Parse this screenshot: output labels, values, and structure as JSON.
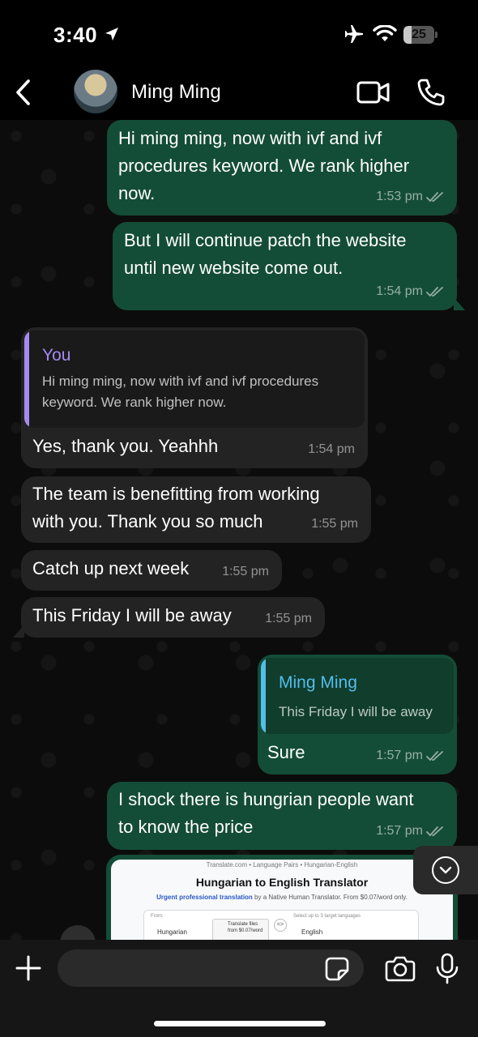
{
  "status_bar": {
    "time": "3:40",
    "battery": "25",
    "battery_level": 0.25
  },
  "header": {
    "contact_name": "Ming Ming"
  },
  "messages": [
    {
      "direction": "out",
      "text": "Hi ming ming, now with ivf and ivf\nprocedures keyword. We rank higher\nnow.",
      "time": "1:53 pm",
      "status": "read"
    },
    {
      "direction": "out",
      "text": "But I will continue patch the website\nuntil new website come out.",
      "time": "1:54 pm",
      "status": "read"
    },
    {
      "direction": "in",
      "quote_author": "You",
      "quote_text": "Hi ming ming, now with ivf and ivf procedures\nkeyword. We rank higher now.",
      "text": "Yes, thank you. Yeahhh",
      "time": "1:54 pm"
    },
    {
      "direction": "in",
      "text": "The team is benefitting from working\nwith you. Thank you so much",
      "time": "1:55 pm"
    },
    {
      "direction": "in",
      "text": "Catch up next week",
      "time": "1:55 pm"
    },
    {
      "direction": "in",
      "text": "This Friday I will be away",
      "time": "1:55 pm"
    },
    {
      "direction": "out",
      "quote_author": "Ming Ming",
      "quote_text": "This Friday I will be away",
      "text": "Sure",
      "time": "1:57 pm",
      "status": "read"
    },
    {
      "direction": "out",
      "text": "I shock there is hungrian people want\nto know the price",
      "time": "1:57 pm",
      "status": "read"
    }
  ],
  "image_preview": {
    "breadcrumbs": "Translate.com  •  Language Pairs  •  Hungarian-English",
    "title": "Hungarian to English Translator",
    "subtitle_link": "Urgent professional translation",
    "subtitle_rest": " by a Native Human Translator. From $0.07/word only.",
    "from_label": "From:",
    "from_value": "Hungarian",
    "files_label": "Translate files",
    "files_price": "from $0.07/word",
    "to_label": "Select up to 3 target languages",
    "to_value": "English"
  },
  "colors": {
    "outgoing_bubble": "#144d37",
    "incoming_bubble": "#232323",
    "quote_bar_you": "#a58bf0",
    "quote_bar_contact": "#53bdeb",
    "quote_author_you": "#a58bf0",
    "quote_author_contact": "#53bdeb"
  },
  "icons": {
    "back": "chevron-left-icon",
    "video": "video-camera-icon",
    "phone": "phone-icon",
    "plus": "plus-icon",
    "sticker": "sticker-icon",
    "camera": "camera-icon",
    "mic": "microphone-icon",
    "scroll": "chevron-down-icon"
  }
}
